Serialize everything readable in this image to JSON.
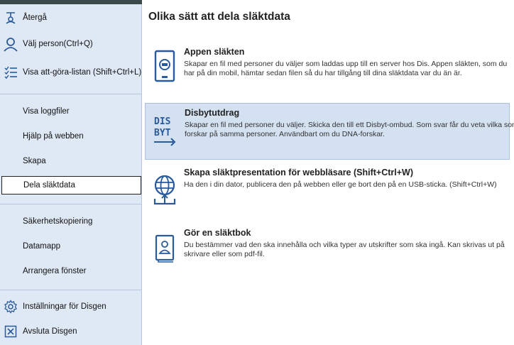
{
  "sidebar": {
    "items": [
      {
        "label": "Återgå",
        "icon": "return-icon"
      },
      {
        "label": "Välj person(Ctrl+Q)",
        "icon": "person-icon"
      },
      {
        "label": "Visa att-göra-listan (Shift+Ctrl+L)",
        "icon": "checklist-icon"
      },
      {
        "label": "Visa loggfiler"
      },
      {
        "label": "Hjälp på webben"
      },
      {
        "label": "Skapa"
      },
      {
        "label": "Dela släktdata",
        "selected": true
      },
      {
        "label": "Säkerhetskopiering"
      },
      {
        "label": "Datamapp"
      },
      {
        "label": "Arrangera fönster"
      },
      {
        "label": "Inställningar för Disgen",
        "icon": "gear-icon"
      },
      {
        "label": "Avsluta Disgen",
        "icon": "exit-icon"
      }
    ]
  },
  "main": {
    "title": "Olika sätt att dela släktdata",
    "options": [
      {
        "title": "Appen släkten",
        "desc": "Skapar en fil med personer du väljer som laddas upp till en server hos Dis. Appen släkten, som du har på din mobil, hämtar sedan filen så du har tillgång till dina släktdata var du än är.",
        "icon": "phone-icon"
      },
      {
        "title": "Disbytutdrag",
        "desc": "Skapar en fil med personer du väljer. Skicka den till ett Disbyt-ombud. Som svar får du veta vilka som forskar på samma personer. Användbart om du DNA-forskar.",
        "icon": "disbyt-icon",
        "icon_text_top": "DIS",
        "icon_text_bottom": "BYT"
      },
      {
        "title": "Skapa släktpresentation för webbläsare (Shift+Ctrl+W)",
        "desc": "Ha den i din dator, publicera den på webben eller ge bort den på en USB-sticka. (Shift+Ctrl+W)",
        "icon": "globe-upload-icon"
      },
      {
        "title": "Gör en släktbok",
        "desc": "Du bestämmer vad den ska innehålla och vilka typer av utskrifter som ska ingå. Kan skrivas ut på skrivare eller som pdf-fil.",
        "icon": "book-icon"
      }
    ]
  },
  "colors": {
    "accent": "#2a5a9e",
    "sidebar_bg": "#dfe9f5",
    "active_bg": "#d3e1f1"
  }
}
